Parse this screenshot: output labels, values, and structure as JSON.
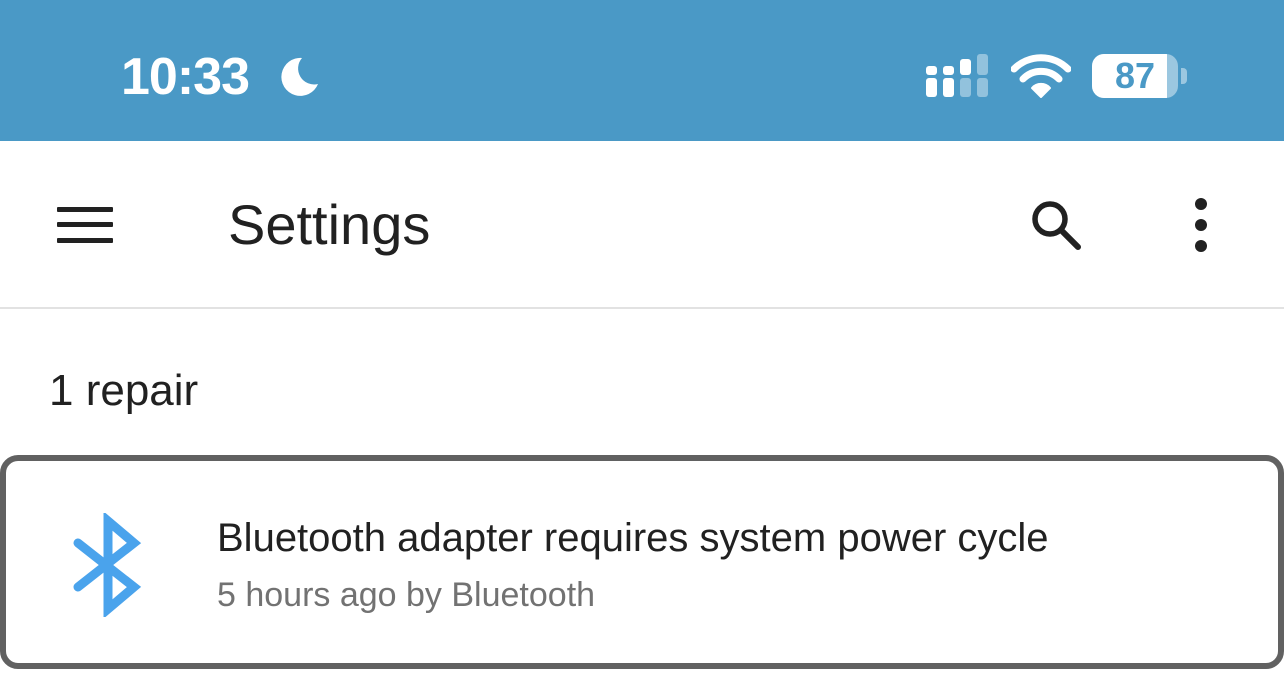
{
  "status_bar": {
    "time": "10:33",
    "moon_icon": "do-not-disturb-moon-icon",
    "signal_icon": "cellular-signal-icon",
    "wifi_icon": "wifi-icon",
    "battery_level": "87",
    "battery_fraction": 0.87,
    "background_color": "#4a99c6"
  },
  "toolbar": {
    "menu_icon": "hamburger-menu-icon",
    "title": "Settings",
    "search_icon": "search-icon",
    "more_icon": "more-vertical-icon"
  },
  "repairs": {
    "section_header": "1 repair",
    "items": [
      {
        "icon": "bluetooth-icon",
        "icon_color": "#4aa3ec",
        "title": "Bluetooth adapter requires system power cycle",
        "subtitle": "5 hours ago by Bluetooth"
      }
    ]
  }
}
